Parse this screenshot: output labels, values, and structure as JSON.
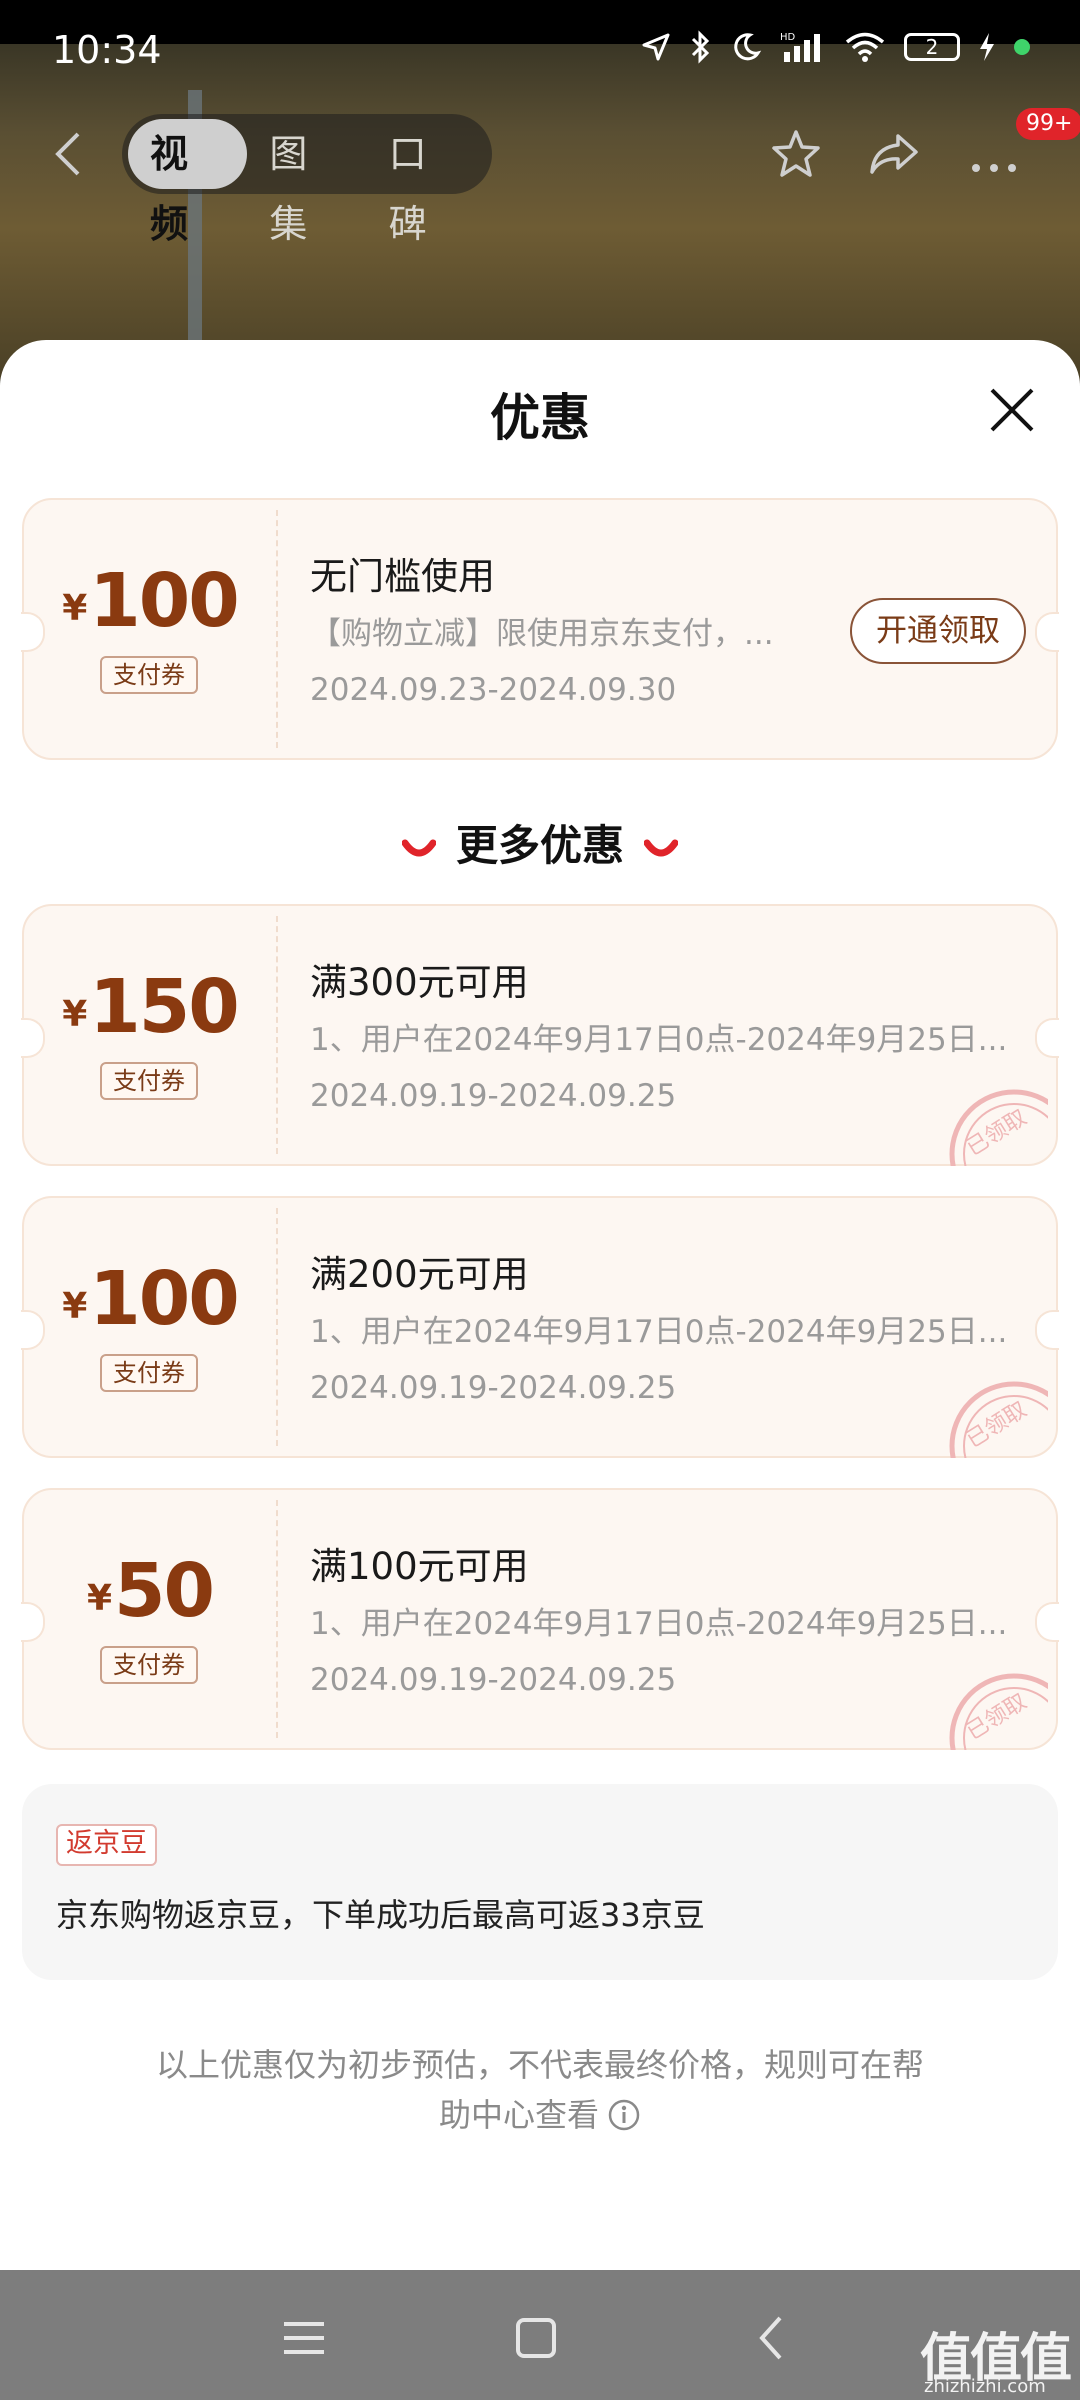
{
  "status_bar": {
    "time": "10:34",
    "battery": "2"
  },
  "nav": {
    "tabs": [
      {
        "label": "视频"
      },
      {
        "label": "图集"
      },
      {
        "label": "口碑"
      }
    ],
    "badge": "99+"
  },
  "sheet": {
    "title": "优惠",
    "main_coupon": {
      "currency": "¥",
      "amount": "100",
      "tag": "支付券",
      "title": "无门槛使用",
      "desc": "【购物立减】限使用京东支付，...",
      "date": "2024.09.23-2024.09.30",
      "button": "开通领取"
    },
    "more_title": "更多优惠",
    "coupons": [
      {
        "currency": "¥",
        "amount": "150",
        "tag": "支付券",
        "title": "满300元可用",
        "desc": "1、用户在2024年9月17日0点-2024年9月25日...",
        "date": "2024.09.19-2024.09.25",
        "stamp": "已领取"
      },
      {
        "currency": "¥",
        "amount": "100",
        "tag": "支付券",
        "title": "满200元可用",
        "desc": "1、用户在2024年9月17日0点-2024年9月25日...",
        "date": "2024.09.19-2024.09.25",
        "stamp": "已领取"
      },
      {
        "currency": "¥",
        "amount": "50",
        "tag": "支付券",
        "title": "满100元可用",
        "desc": "1、用户在2024年9月17日0点-2024年9月25日...",
        "date": "2024.09.19-2024.09.25",
        "stamp": "已领取"
      }
    ],
    "rebate": {
      "tag": "返京豆",
      "text": "京东购物返京豆，下单成功后最高可返33京豆"
    },
    "footnote": {
      "line1": "以上优惠仅为初步预估，不代表最终价格，规则可在帮",
      "line2": "助中心查看"
    }
  },
  "watermark": {
    "text": "值值值",
    "sub": "zhizhizhi.com"
  },
  "colors": {
    "accent": "#8a3a10",
    "stamp": "#e8a4a4",
    "red": "#e0242a"
  }
}
